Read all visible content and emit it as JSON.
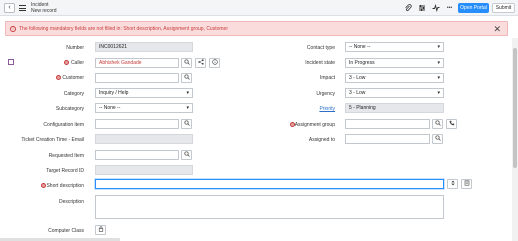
{
  "header": {
    "record_type": "Incident",
    "record_name": "New record",
    "open_portal_label": "Open Portal",
    "submit_label": "Submit",
    "back_icon": "chevron-left-icon",
    "menu_icon": "hamburger-icon",
    "attach_icon": "paperclip-icon",
    "settings_icon": "sliders-icon",
    "activity_icon": "activity-icon",
    "more_label": "•••",
    "accent_color": "#278efc"
  },
  "alert": {
    "text": "The following mandatory fields are not filled in: Short description, Assignment group, Customer",
    "icon": "error-circle-icon",
    "close_label": "✕",
    "color": "#c83c3c"
  },
  "left": {
    "number": {
      "label": "Number",
      "value": "INC0012621"
    },
    "caller": {
      "label": "Caller",
      "value": "Abhishek Gandade"
    },
    "customer": {
      "label": "Customer",
      "value": ""
    },
    "category": {
      "label": "Category",
      "value": "Inquiry / Help"
    },
    "subcategory": {
      "label": "Subcategory",
      "value": "-- None --"
    },
    "config_item": {
      "label": "Configuration item",
      "value": ""
    },
    "ticket_creation": {
      "label": "Ticket Creation Time - Email",
      "value": ""
    },
    "requested_item": {
      "label": "Requested Item",
      "value": ""
    },
    "target_record": {
      "label": "Target Record ID",
      "value": ""
    },
    "short_description": {
      "label": "Short description",
      "value": ""
    },
    "description": {
      "label": "Description",
      "value": ""
    },
    "computer_class": {
      "label": "Computer Class",
      "value": ""
    }
  },
  "right": {
    "contact_type": {
      "label": "Contact type",
      "value": "-- None --"
    },
    "incident_state": {
      "label": "Incident state",
      "value": "In Progress"
    },
    "impact": {
      "label": "Impact",
      "value": "3 - Low"
    },
    "urgency": {
      "label": "Urgency",
      "value": "3 - Low"
    },
    "priority": {
      "label": "Priority",
      "value": "5 - Planning"
    },
    "assignment_group": {
      "label": "Assignment group",
      "value": ""
    },
    "assigned_to": {
      "label": "Assigned to",
      "value": ""
    }
  }
}
